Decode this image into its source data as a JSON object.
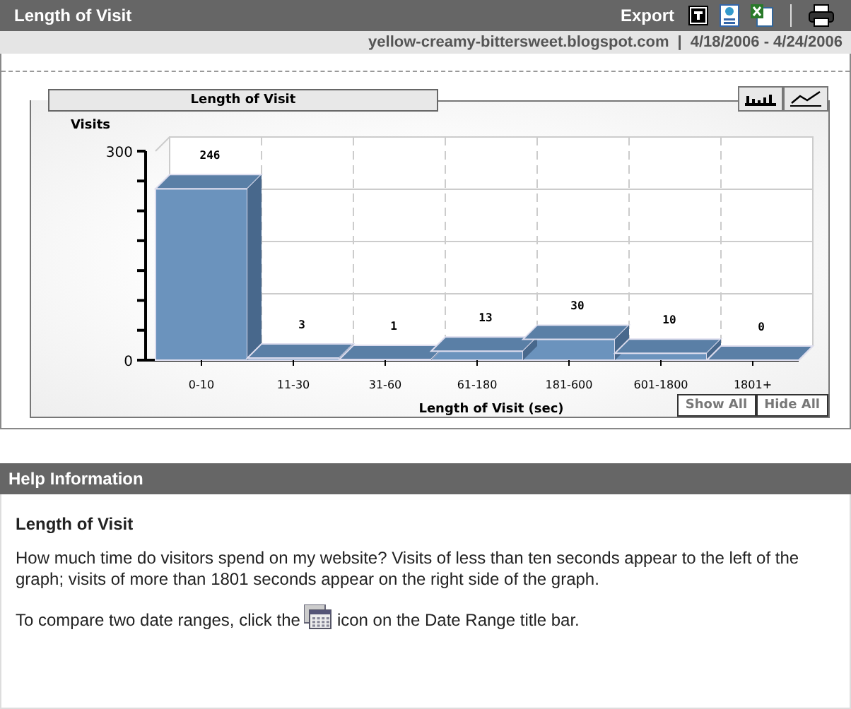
{
  "header": {
    "title": "Length of Visit",
    "export_label": "Export"
  },
  "subheader": {
    "site": "yellow-creamy-bittersweet.blogspot.com",
    "separator": "|",
    "date_range": "4/18/2006 - 4/24/2006"
  },
  "chart_panel": {
    "chart_data": {
      "type": "bar",
      "title": "Length of Visit",
      "xlabel": "Length of Visit (sec)",
      "ylabel": "Visits",
      "categories": [
        "0-10",
        "11-30",
        "31-60",
        "61-180",
        "181-600",
        "601-1800",
        "1801+"
      ],
      "series": [
        {
          "color": "#6b93bd",
          "values": [
            246,
            3,
            1,
            13,
            30,
            10,
            0
          ]
        }
      ],
      "ylim": [
        0,
        300
      ],
      "yticks": [
        0,
        300
      ],
      "data_labels": true
    },
    "buttons": [
      "Show All",
      "Hide All"
    ]
  },
  "help": {
    "title": "Help Information",
    "heading": "Length of Visit",
    "paragraph": "How much time do visitors spend on my website? Visits of less than ten seconds appear to the left of the graph; visits of more than 1801 seconds appear on the right side of the graph.",
    "compare_before": "To compare two date ranges, click the",
    "compare_after": "icon on the Date Range title bar."
  }
}
